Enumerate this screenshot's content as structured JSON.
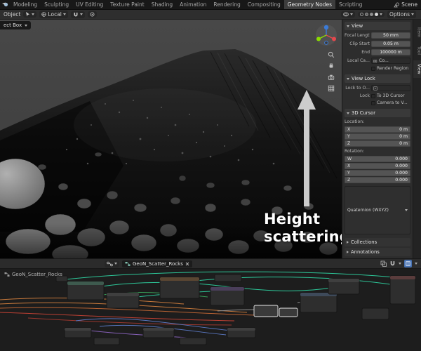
{
  "topbar": {
    "tabs": [
      {
        "label": "Modeling"
      },
      {
        "label": "Sculpting"
      },
      {
        "label": "UV Editing"
      },
      {
        "label": "Texture Paint"
      },
      {
        "label": "Shading"
      },
      {
        "label": "Animation"
      },
      {
        "label": "Rendering"
      },
      {
        "label": "Compositing"
      },
      {
        "label": "Geometry Nodes"
      },
      {
        "label": "Scripting"
      }
    ],
    "scene_label": "Scene"
  },
  "viewport_header": {
    "object_menu_label": "Object",
    "orientation_label": "Local",
    "options_label": "Options"
  },
  "tool_header": {
    "active_tool_label": "ect Box"
  },
  "viewport_overlay": {
    "line1": "Height",
    "line2": "scattering"
  },
  "sidebar": {
    "tabs": [
      {
        "label": "Item"
      },
      {
        "label": "Tool"
      },
      {
        "label": "View"
      }
    ],
    "view_panel": {
      "title": "View",
      "focal_length_label": "Focal Length",
      "focal_length_value": "50 mm",
      "clip_start_label": "Clip Start",
      "clip_start_value": "0.05 m",
      "clip_end_label": "End",
      "clip_end_value": "100000 m",
      "local_camera_label": "Local Ca...",
      "local_camera_value": "Co...",
      "render_region_label": "Render Region"
    },
    "view_lock_panel": {
      "title": "View Lock",
      "lock_to_object_label": "Lock to O...",
      "lock_label": "Lock",
      "to_3d_cursor_label": "To 3D Cursor",
      "camera_to_view_label": "Camera to V..."
    },
    "cursor_panel": {
      "title": "3D Cursor",
      "location_label": "Location:",
      "location_rows": [
        {
          "axis": "X",
          "value": "0 m"
        },
        {
          "axis": "Y",
          "value": "0 m"
        },
        {
          "axis": "Z",
          "value": "0 m"
        }
      ],
      "rotation_label": "Rotation:",
      "rotation_rows": [
        {
          "axis": "W",
          "value": "0.000"
        },
        {
          "axis": "X",
          "value": "0.000"
        },
        {
          "axis": "Y",
          "value": "0.000"
        },
        {
          "axis": "Z",
          "value": "0.000"
        }
      ],
      "rotation_mode": "Quaternion (WXYZ)"
    },
    "collections_panel_title": "Collections",
    "annotations_panel_title": "Annotations"
  },
  "node_editor": {
    "tree_name": "GeoN_Scatter_Rocks",
    "overlay_tree_name": "GeoN_Scatter_Rocks"
  },
  "colors": {
    "accent_blue": "#4772b3",
    "wire_teal": "#2fd9a6",
    "wire_orange": "#d8823f",
    "wire_red": "#cf4436",
    "wire_blue": "#5f7fd0",
    "wire_purple": "#9067c6",
    "axis_x": "#e5484d",
    "axis_y": "#8bdc00",
    "axis_z": "#3b7bd8"
  }
}
